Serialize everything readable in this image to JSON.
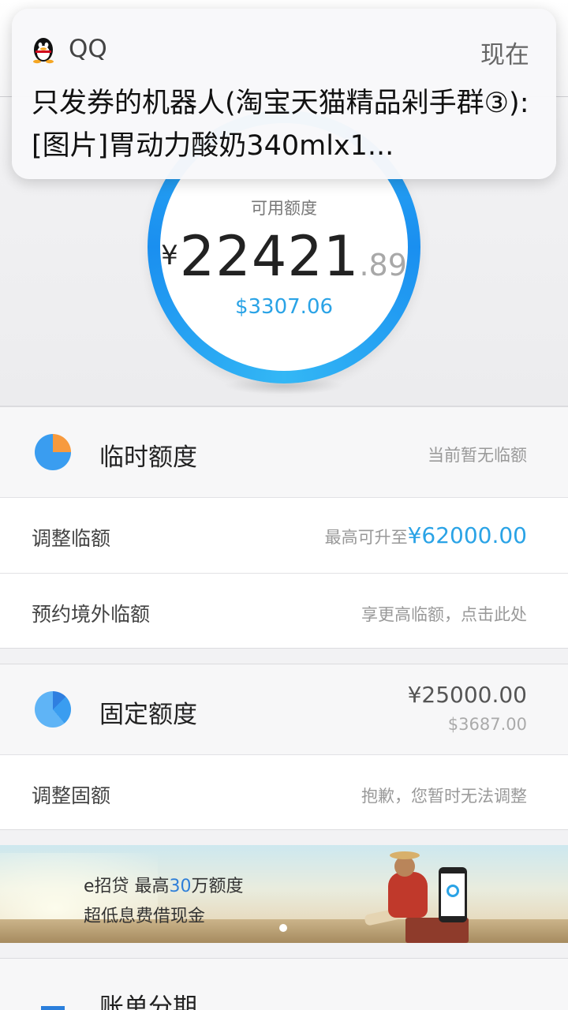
{
  "notification": {
    "app_name": "QQ",
    "time": "现在",
    "message": "只发券的机器人(淘宝天猫精品剁手群③):[图片]胃动力酸奶340mlx1..."
  },
  "credit": {
    "label": "可用额度",
    "currency_symbol": "¥",
    "amount_int": "22421",
    "amount_dec": ".89",
    "usd": "$3307.06"
  },
  "temp_limit": {
    "title": "临时额度",
    "status": "当前暂无临额",
    "adjust_label": "调整临额",
    "adjust_prefix": "最高可升至",
    "adjust_amount": "¥62000.00",
    "overseas_label": "预约境外临额",
    "overseas_hint": "享更高临额，点击此处"
  },
  "fixed_limit": {
    "title": "固定额度",
    "amount": "¥25000.00",
    "usd": "$3687.00",
    "adjust_label": "调整固额",
    "adjust_hint": "抱歉，您暂时无法调整"
  },
  "banner": {
    "line1_a": "e招贷  最高",
    "line1_num": "30",
    "line1_b": "万额度",
    "line2": "超低息费借现金"
  },
  "installment": {
    "title": "账单分期"
  },
  "colors": {
    "accent": "#2aa3e6",
    "ring": "#1a8ff0",
    "pie_orange": "#f79a3e"
  }
}
